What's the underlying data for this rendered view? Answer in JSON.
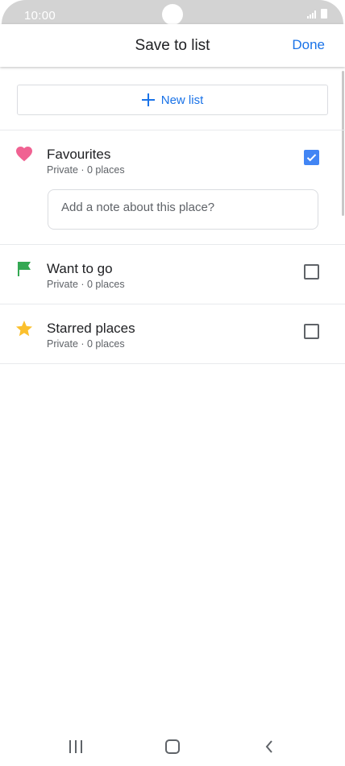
{
  "status_bar": {
    "time": "10:00"
  },
  "header": {
    "title": "Save to list",
    "done_label": "Done"
  },
  "new_list": {
    "label": "New list"
  },
  "lists": [
    {
      "title": "Favourites",
      "subtitle": "Private · 0 places",
      "icon": "heart-icon",
      "icon_color": "#f06292",
      "checked": true
    },
    {
      "title": "Want to go",
      "subtitle": "Private · 0 places",
      "icon": "flag-icon",
      "icon_color": "#34a853",
      "checked": false
    },
    {
      "title": "Starred places",
      "subtitle": "Private · 0 places",
      "icon": "star-icon",
      "icon_color": "#fbc02d",
      "checked": false
    }
  ],
  "note": {
    "placeholder": "Add a note about this place?"
  },
  "colors": {
    "accent": "#1a73e8",
    "checkbox_checked": "#4285f4"
  },
  "nav": {
    "recents": "recents-icon",
    "home": "home-icon",
    "back": "back-icon"
  }
}
